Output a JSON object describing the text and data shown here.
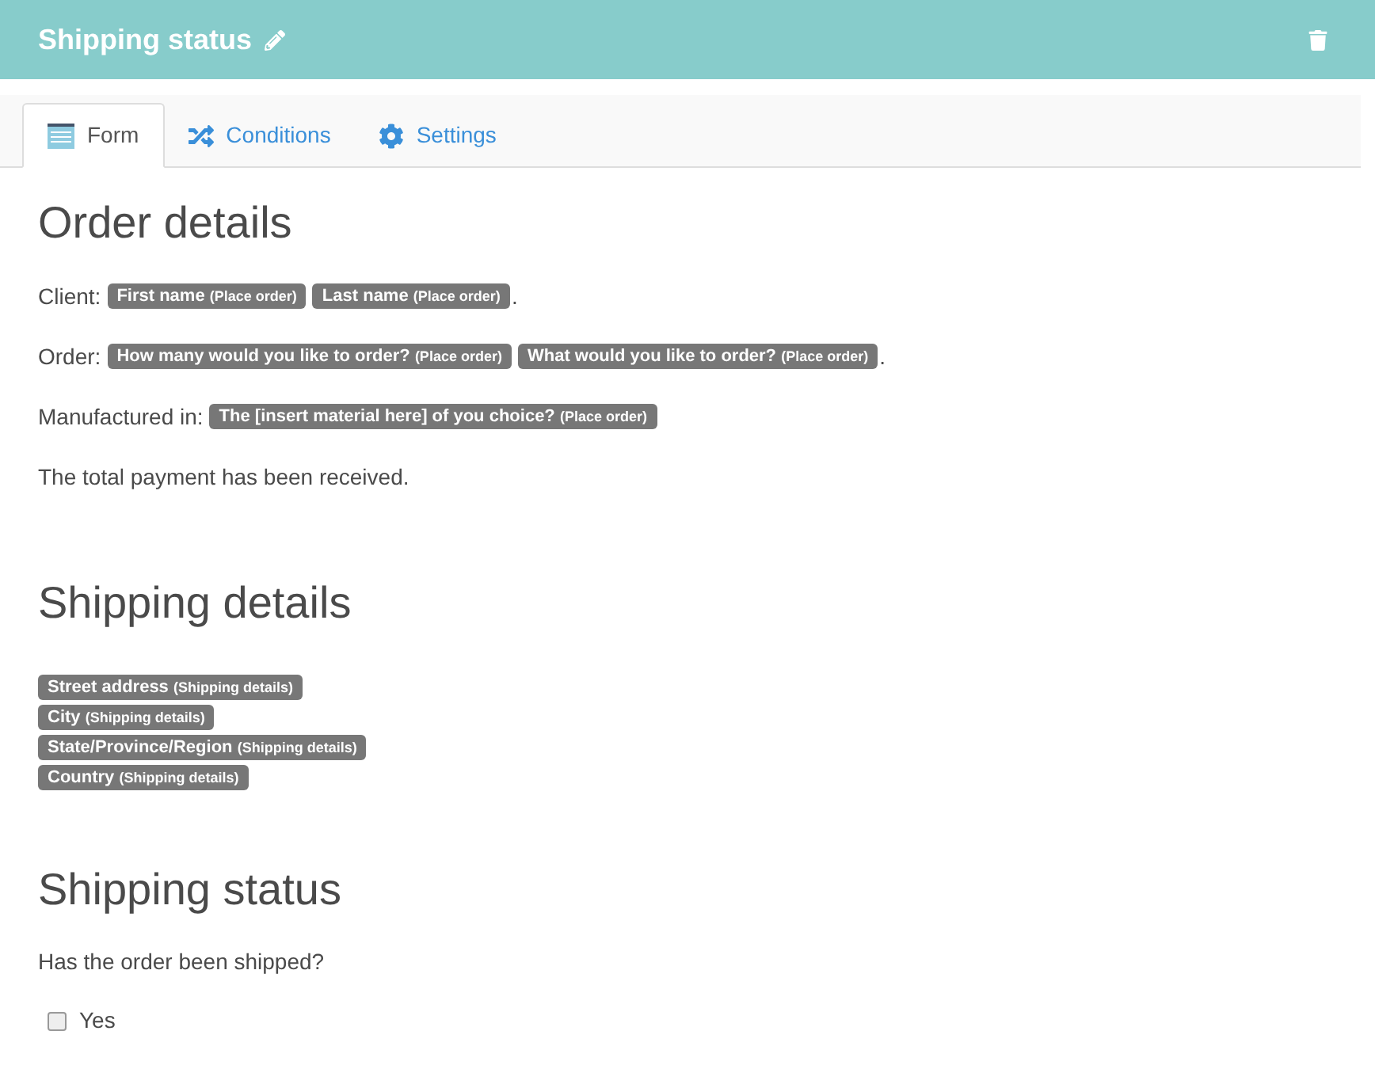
{
  "header": {
    "title": "Shipping status"
  },
  "tabs": [
    {
      "label": "Form",
      "kind": "form",
      "selected": true
    },
    {
      "label": "Conditions",
      "kind": "conditions",
      "selected": false
    },
    {
      "label": "Settings",
      "kind": "settings",
      "selected": false
    }
  ],
  "sections": [
    {
      "title": "Order details",
      "kind": "lines",
      "lines": [
        {
          "label": "Client:",
          "tags": [
            {
              "name": "First name",
              "source": "(Place order)"
            },
            {
              "name": "Last name",
              "source": "(Place order)"
            }
          ],
          "suffix": "."
        },
        {
          "label": "Order:",
          "tags": [
            {
              "name": "How many would you like to order?",
              "source": "(Place order)"
            },
            {
              "name": "What would you like to order?",
              "source": "(Place order)"
            }
          ],
          "suffix": "."
        },
        {
          "label": "Manufactured in:",
          "tags": [
            {
              "name": "The [insert material here] of you choice?",
              "source": "(Place order)"
            }
          ]
        },
        {
          "label": "The total payment has been received."
        }
      ]
    },
    {
      "title": "Shipping details",
      "kind": "stacked",
      "tags": [
        {
          "name": "Street address",
          "source": "(Shipping details)"
        },
        {
          "name": "City",
          "source": "(Shipping details)"
        },
        {
          "name": "State/Province/Region",
          "source": "(Shipping details)"
        },
        {
          "name": "Country",
          "source": "(Shipping details)"
        }
      ]
    },
    {
      "title": "Shipping status",
      "kind": "question",
      "question": "Has the order been shipped?",
      "options": [
        {
          "label": "Yes",
          "checked": false
        }
      ]
    }
  ]
}
